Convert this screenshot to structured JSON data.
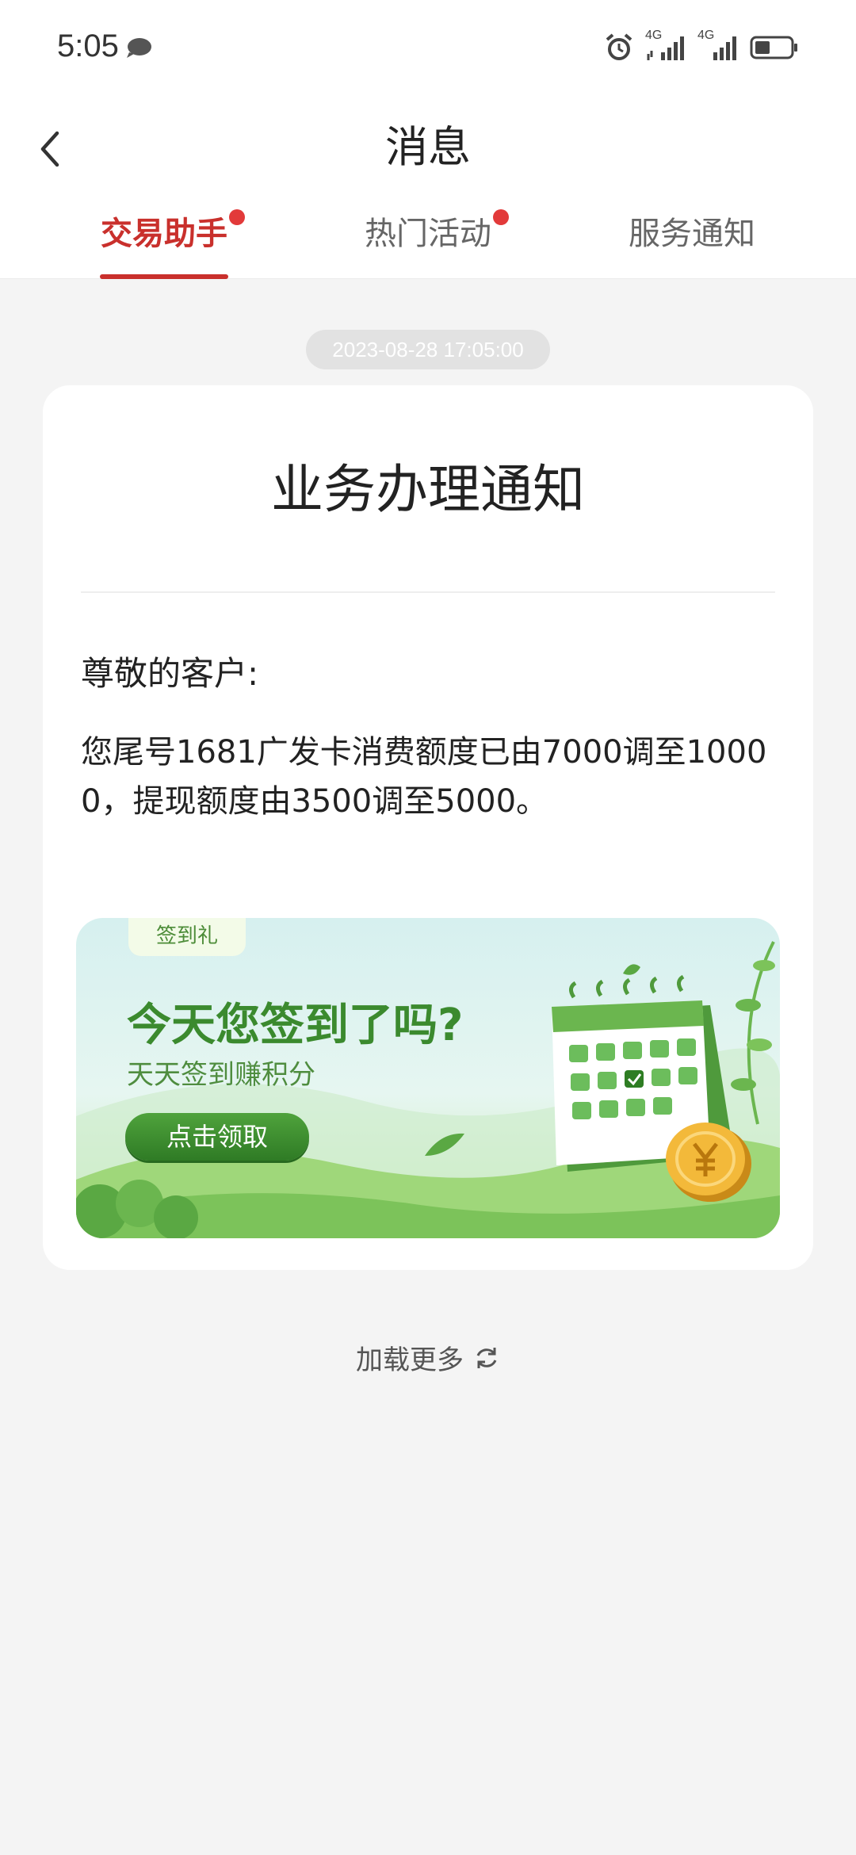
{
  "status_bar": {
    "time": "5:05",
    "network_1": "4G",
    "network_2": "4G"
  },
  "header": {
    "title": "消息"
  },
  "tabs": [
    {
      "label": "交易助手",
      "active": true,
      "has_dot": true
    },
    {
      "label": "热门活动",
      "active": false,
      "has_dot": true
    },
    {
      "label": "服务通知",
      "active": false,
      "has_dot": false
    }
  ],
  "message": {
    "timestamp": "2023-08-28 17:05:00",
    "title": "业务办理通知",
    "greeting": "尊敬的客户:",
    "body": "您尾号1681广发卡消费额度已由7000调至10000，提现额度由3500调至5000。"
  },
  "banner": {
    "tag": "签到礼",
    "title": "今天您签到了吗?",
    "subtitle": "天天签到赚积分",
    "button": "点击领取"
  },
  "footer": {
    "load_more": "加载更多"
  },
  "colors": {
    "accent": "#c9302c",
    "dot": "#e23a3a",
    "background": "#f4f4f4",
    "banner_green": "#3b8a2e"
  },
  "icons": [
    "back-arrow-icon",
    "chat-bubble-icon",
    "alarm-icon",
    "signal-icon",
    "battery-icon",
    "refresh-icon"
  ]
}
